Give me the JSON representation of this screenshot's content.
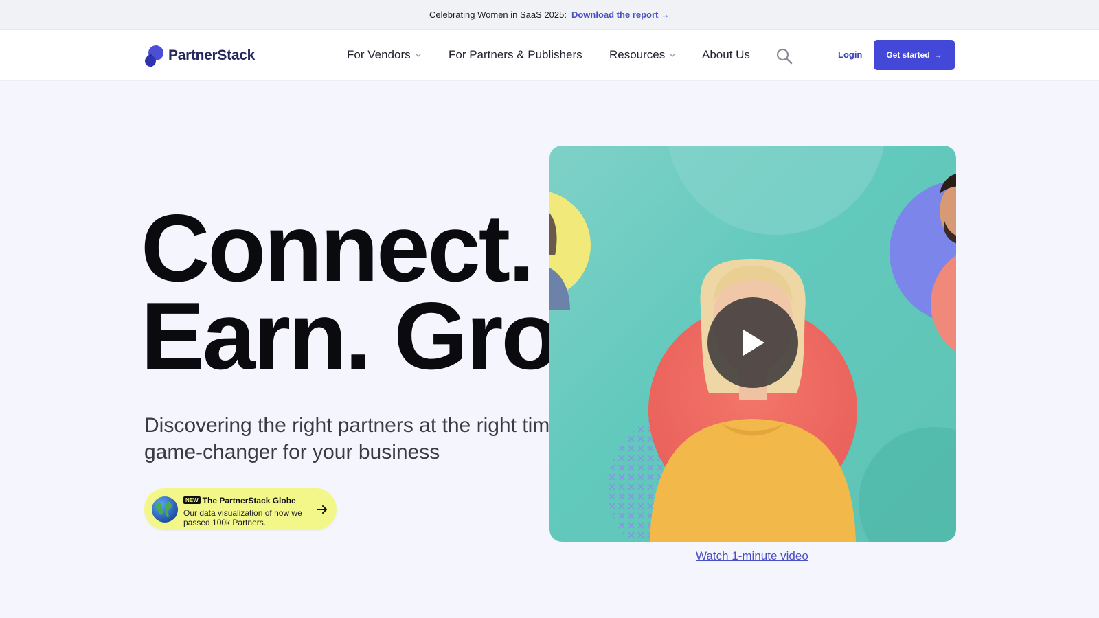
{
  "announcement": {
    "text": "Celebrating Women in SaaS 2025:",
    "link_label": "Download the report →"
  },
  "header": {
    "logo_text": "PartnerStack",
    "nav": [
      {
        "label": "For Vendors",
        "has_dropdown": true
      },
      {
        "label": "For Partners & Publishers",
        "has_dropdown": false
      },
      {
        "label": "Resources",
        "has_dropdown": true
      },
      {
        "label": "About Us",
        "has_dropdown": false
      }
    ],
    "search_icon": "search-icon",
    "login_label": "Login",
    "cta_label": "Get started",
    "cta_arrow": "→"
  },
  "hero": {
    "title_line1": "Connect.",
    "title_line2": "Earn. Grow.",
    "subtitle": "Discovering the right partners at the right time is a game-changer for your business"
  },
  "globe_card": {
    "badge": "NEW",
    "title": "The PartnerStack Globe",
    "description": "Our data visualization of how we passed 100k Partners.",
    "icon": "globe-icon"
  },
  "video": {
    "watch_label": "Watch 1-minute video"
  },
  "colors": {
    "accent": "#4448d8",
    "link": "#4a4fc4",
    "card": "#f3f78a",
    "page_bg": "#f5f6fd"
  }
}
